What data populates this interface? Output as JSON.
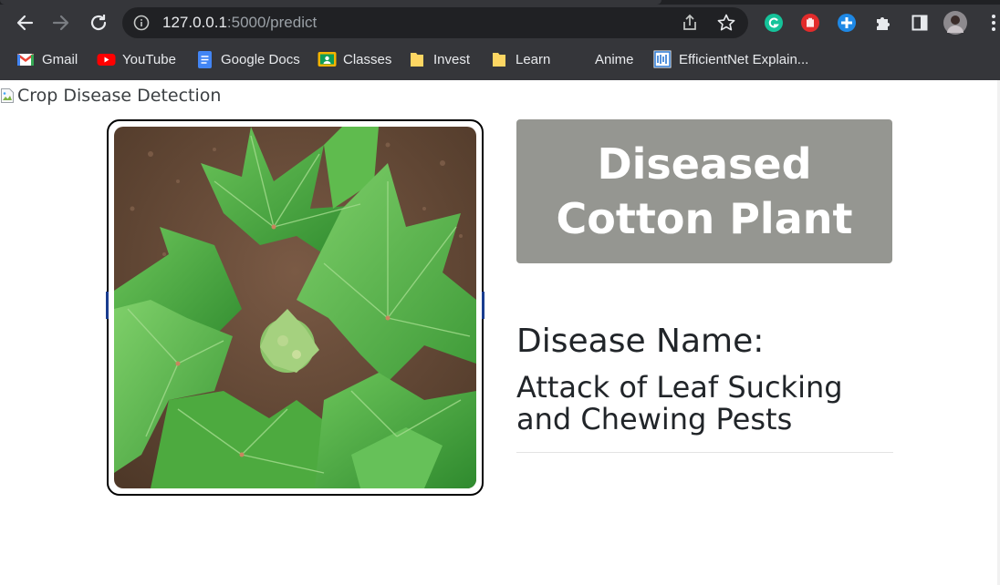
{
  "browser": {
    "url_host": "127.0.0.1",
    "url_rest": ":5000/predict",
    "bookmarks": [
      {
        "label": "Gmail",
        "icon": "gmail-icon"
      },
      {
        "label": "YouTube",
        "icon": "youtube-icon"
      },
      {
        "label": "Google Docs",
        "icon": "docs-icon"
      },
      {
        "label": "Classes",
        "icon": "classroom-icon"
      },
      {
        "label": "Invest",
        "icon": "folder-icon"
      },
      {
        "label": "Learn",
        "icon": "folder-icon"
      },
      {
        "label": "Anime",
        "icon": "blank-icon"
      },
      {
        "label": "EfficientNet Explain...",
        "icon": "efficientnet-icon"
      }
    ]
  },
  "page": {
    "header_alt": "Crop Disease Detection",
    "result_title": "Diseased Cotton Plant",
    "disease_label": "Disease Name:",
    "disease_name": "Attack of Leaf Sucking and Chewing Pests"
  },
  "colors": {
    "result_box": "#959691",
    "chrome": "#35363a",
    "omnibox": "#202124"
  }
}
